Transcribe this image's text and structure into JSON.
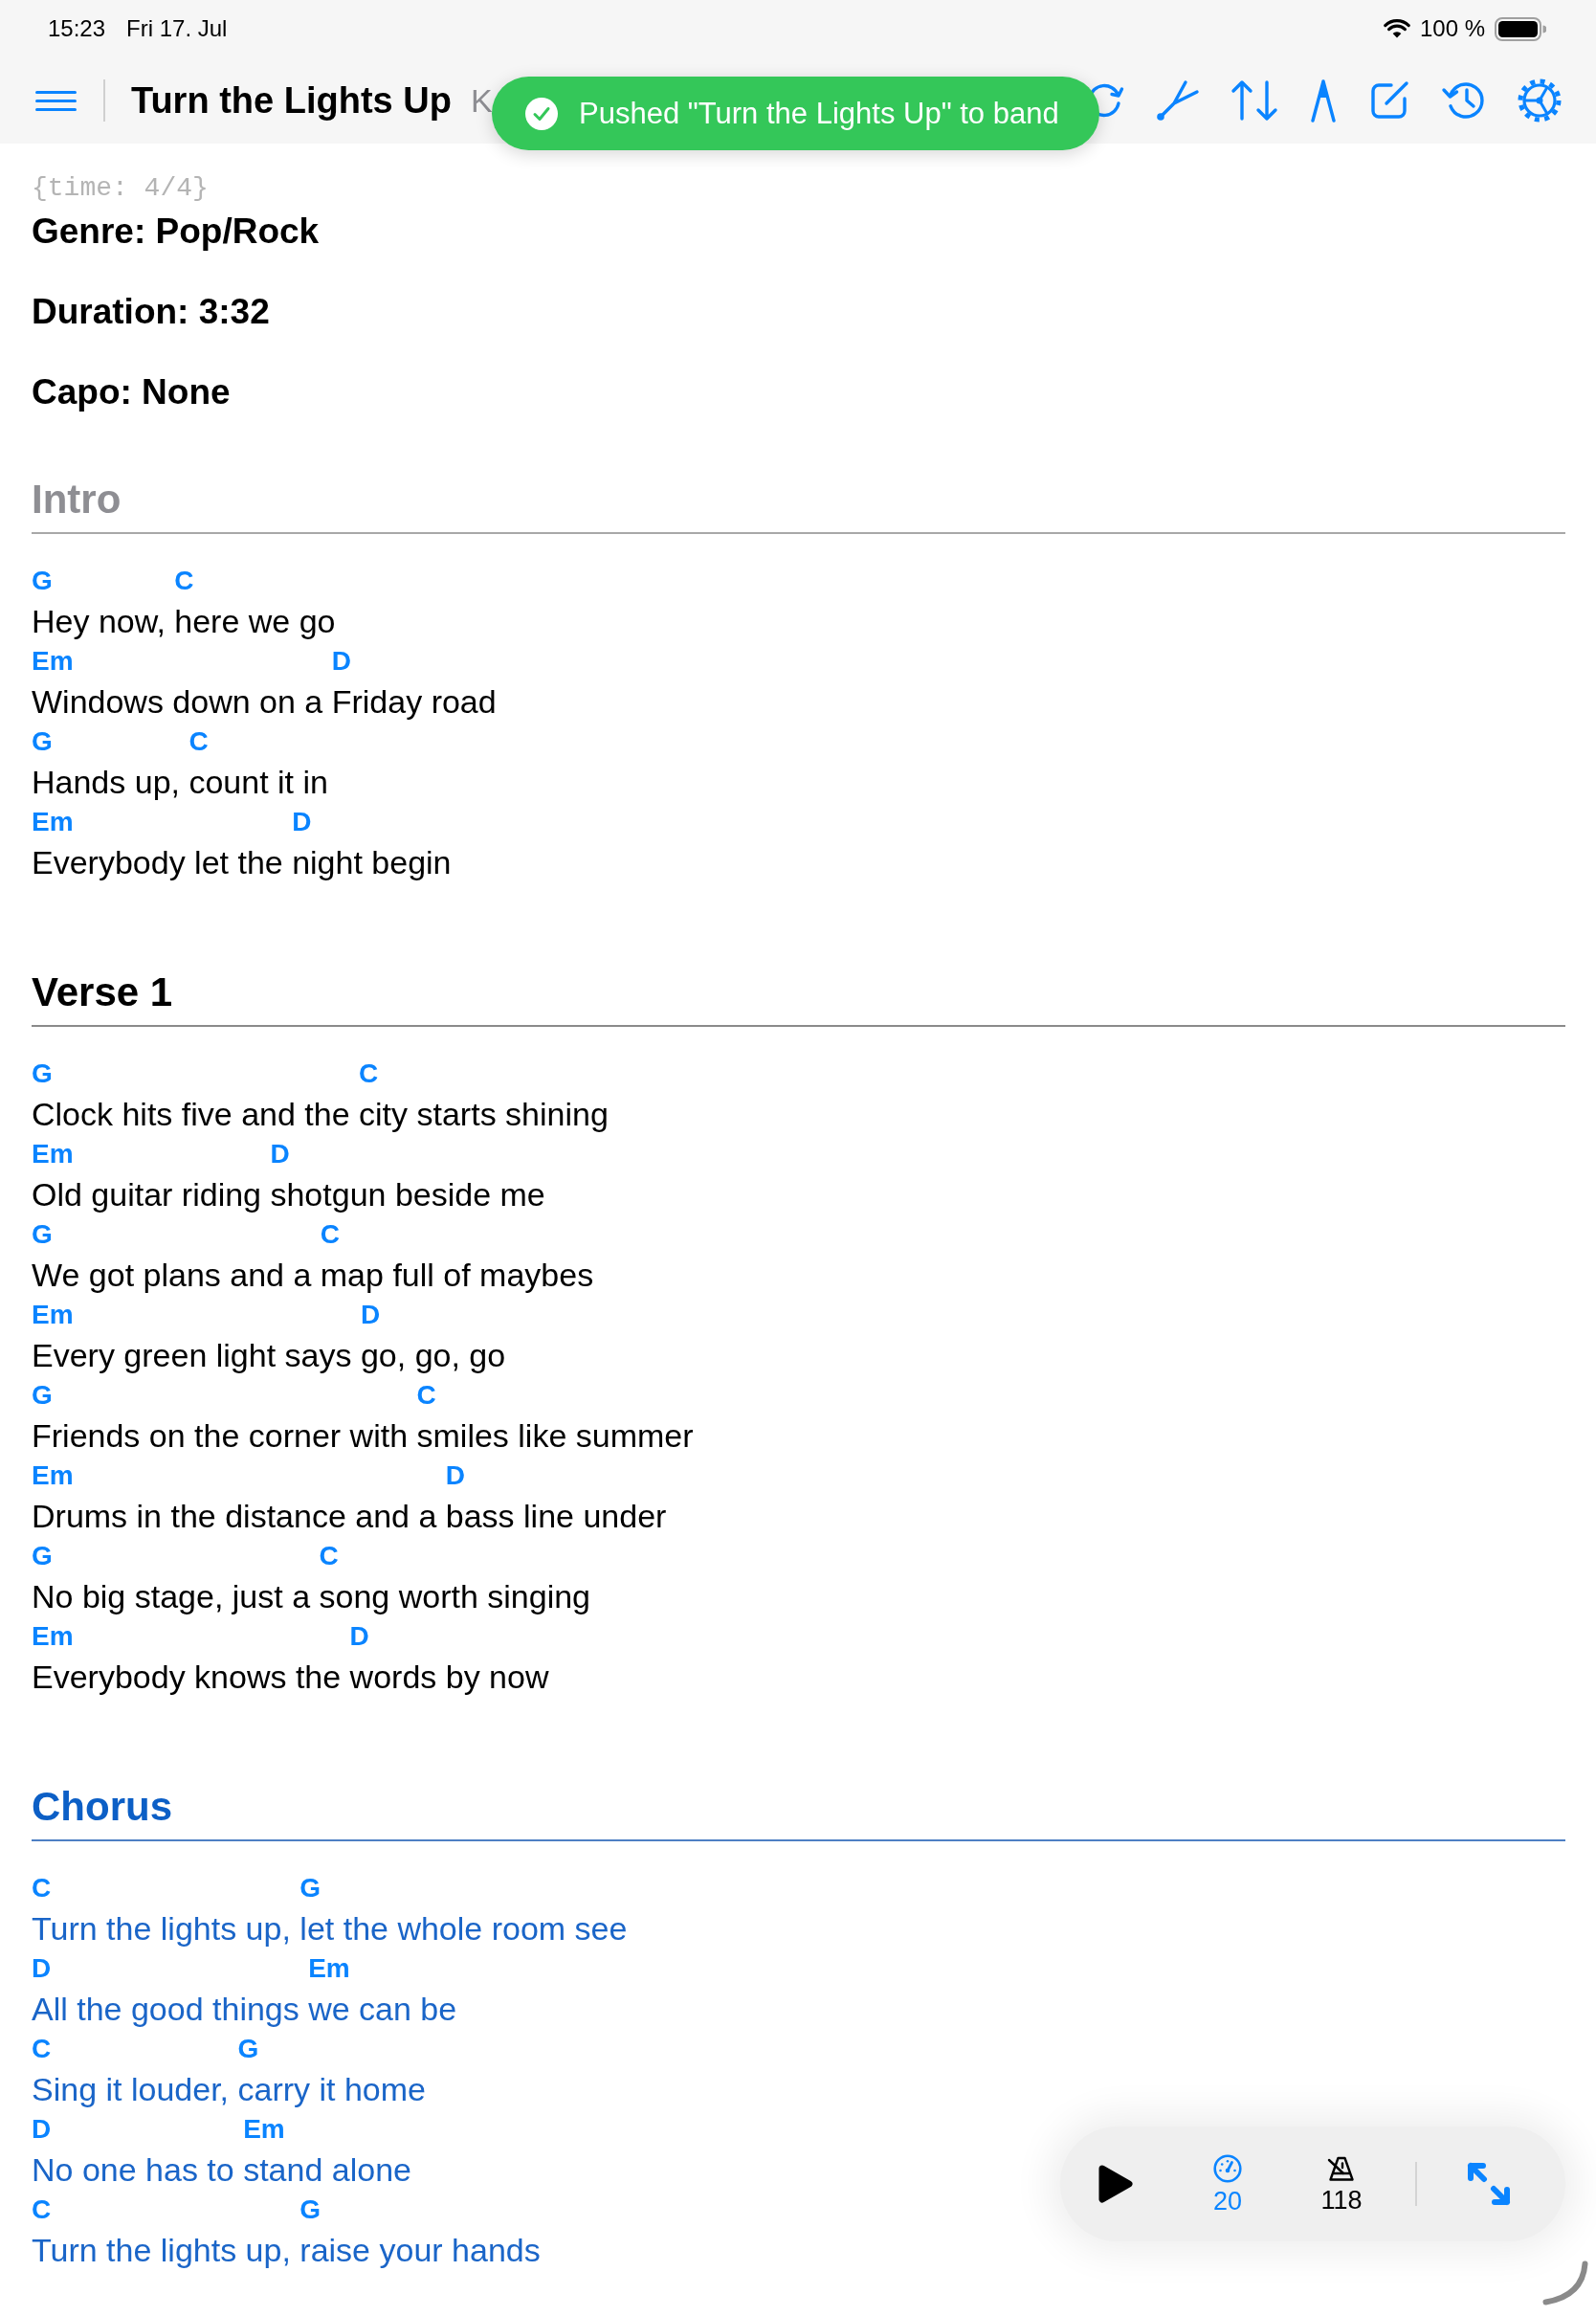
{
  "status_bar": {
    "time": "15:23",
    "date": "Fri 17. Jul",
    "battery": "100 %"
  },
  "nav_bar": {
    "title": "Turn the Lights Up",
    "subtitle": "K"
  },
  "toast": {
    "message": "Pushed \"Turn the Lights Up\" to band"
  },
  "song": {
    "directive": "{time: 4/4}",
    "metadata": [
      "Genre: Pop/Rock",
      "Duration: 3:32",
      "Capo: None"
    ],
    "sections": [
      {
        "kind": "intro",
        "title": "Intro",
        "lines": [
          {
            "segments": [
              {
                "chord": "G",
                "text": "Hey now, "
              },
              {
                "chord": "C",
                "text": "here we go"
              }
            ]
          },
          {
            "segments": [
              {
                "chord": "Em",
                "text": "Windows down on a "
              },
              {
                "chord": "D",
                "text": "Friday road"
              }
            ]
          },
          {
            "segments": [
              {
                "chord": "G",
                "text": "Hands up, "
              },
              {
                "chord": "C",
                "text": "count it in"
              }
            ]
          },
          {
            "segments": [
              {
                "chord": "Em",
                "text": "Everybody let the "
              },
              {
                "chord": "D",
                "text": "night begin"
              }
            ]
          }
        ]
      },
      {
        "kind": "verse",
        "title": "Verse 1",
        "lines": [
          {
            "segments": [
              {
                "chord": "G",
                "text": "Clock hits five and the "
              },
              {
                "chord": "C",
                "text": "city starts shining"
              }
            ]
          },
          {
            "segments": [
              {
                "chord": "Em",
                "text": "Old guitar riding "
              },
              {
                "chord": "D",
                "text": "shotgun beside me"
              }
            ]
          },
          {
            "segments": [
              {
                "chord": "G",
                "text": "We got plans and a "
              },
              {
                "chord": "C",
                "text": "map full of maybes"
              }
            ]
          },
          {
            "segments": [
              {
                "chord": "Em",
                "text": "Every green light says "
              },
              {
                "chord": "D",
                "text": "go, go, go"
              }
            ]
          },
          {
            "segments": [
              {
                "chord": "G",
                "text": "Friends on the corner with "
              },
              {
                "chord": "C",
                "text": "smiles like summer"
              }
            ]
          },
          {
            "segments": [
              {
                "chord": "Em",
                "text": "Drums in the distance and a "
              },
              {
                "chord": "D",
                "text": "bass line under"
              }
            ]
          },
          {
            "segments": [
              {
                "chord": "G",
                "text": "No big stage, just a "
              },
              {
                "chord": "C",
                "text": "song worth singing"
              }
            ]
          },
          {
            "segments": [
              {
                "chord": "Em",
                "text": "Everybody knows the "
              },
              {
                "chord": "D",
                "text": "words by now"
              }
            ]
          }
        ]
      },
      {
        "kind": "chorus",
        "title": "Chorus",
        "lines": [
          {
            "segments": [
              {
                "chord": "C",
                "text": "Turn the lights up, "
              },
              {
                "chord": "G",
                "text": "let the whole room see"
              }
            ]
          },
          {
            "segments": [
              {
                "chord": "D",
                "text": "All the good things "
              },
              {
                "chord": "Em",
                "text": "we can be"
              }
            ]
          },
          {
            "segments": [
              {
                "chord": "C",
                "text": "Sing it louder, "
              },
              {
                "chord": "G",
                "text": "carry it home"
              }
            ]
          },
          {
            "segments": [
              {
                "chord": "D",
                "text": "No one has to "
              },
              {
                "chord": "Em",
                "text": "stand alone"
              }
            ]
          },
          {
            "segments": [
              {
                "chord": "C",
                "text": "Turn the lights up, "
              },
              {
                "chord": "G",
                "text": "raise your hands"
              }
            ]
          }
        ]
      }
    ]
  },
  "playback_bar": {
    "scroll_speed": {
      "value": "20",
      "active": true
    },
    "metronome": {
      "value": "118",
      "active": false
    }
  }
}
